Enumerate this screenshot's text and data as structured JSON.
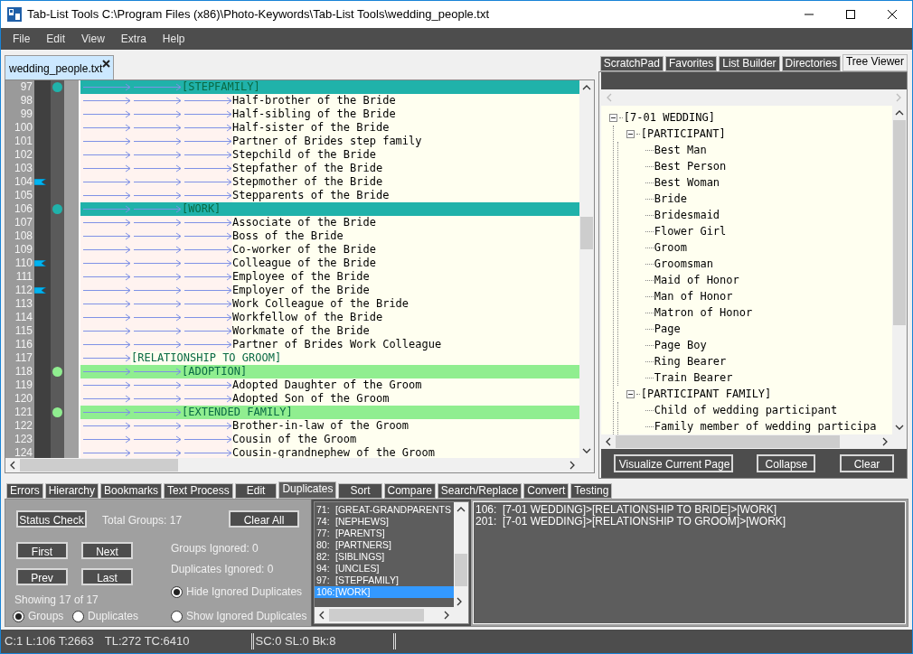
{
  "window": {
    "title": "Tab-List Tools C:\\Program Files (x86)\\Photo-Keywords\\Tab-List Tools\\wedding_people.txt"
  },
  "menu": [
    "File",
    "Edit",
    "View",
    "Extra",
    "Help"
  ],
  "document_tabs": [
    {
      "label": "wedding_people.txt",
      "selected": true
    }
  ],
  "editor": {
    "lines": [
      {
        "children": [
          {
            "number": "97",
            "kind": "group",
            "text": "[STEPFAMILY]",
            "color": "#20b2aa",
            "bookmarked": false,
            "children": [
              {
                "number": "98",
                "kind": "item",
                "text": "Half-brother of the Bride",
                "bookmarked": false
              },
              {
                "number": "99",
                "kind": "item",
                "text": "Half-sibling of the Bride",
                "bookmarked": false
              },
              {
                "number": "100",
                "kind": "item",
                "text": "Half-sister of the Bride",
                "bookmarked": false
              },
              {
                "number": "101",
                "kind": "item",
                "text": "Partner of Brides step family",
                "bookmarked": false
              },
              {
                "number": "102",
                "kind": "item",
                "text": "Stepchild of the Bride",
                "bookmarked": false
              },
              {
                "number": "103",
                "kind": "item",
                "text": "Stepfather of the Bride",
                "bookmarked": false
              },
              {
                "number": "104",
                "kind": "item",
                "text": "Stepmother of the Bride",
                "bookmarked": true
              },
              {
                "number": "105",
                "kind": "item",
                "text": "Stepparents of the Bride",
                "bookmarked": false
              }
            ]
          },
          {
            "number": "106",
            "kind": "group",
            "text": "[WORK]",
            "color": "#20b2aa",
            "bookmarked": false,
            "children": [
              {
                "number": "107",
                "kind": "item",
                "text": "Associate of the Bride",
                "bookmarked": false
              },
              {
                "number": "108",
                "kind": "item",
                "text": "Boss of the Bride",
                "bookmarked": false
              },
              {
                "number": "109",
                "kind": "item",
                "text": "Co-worker of the Bride",
                "bookmarked": false
              },
              {
                "number": "110",
                "kind": "item",
                "text": "Colleague of the Bride",
                "bookmarked": true
              },
              {
                "number": "111",
                "kind": "item",
                "text": "Employee of the Bride",
                "bookmarked": false
              },
              {
                "number": "112",
                "kind": "item",
                "text": "Employer of the Bride",
                "bookmarked": true
              },
              {
                "number": "113",
                "kind": "item",
                "text": "Work Colleague of the Bride",
                "bookmarked": false
              },
              {
                "number": "114",
                "kind": "item",
                "text": "Workfellow of the Bride",
                "bookmarked": false
              },
              {
                "number": "115",
                "kind": "item",
                "text": "Workmate of the Bride",
                "bookmarked": false
              },
              {
                "number": "116",
                "kind": "item",
                "text": "Partner of Brides Work Colleague",
                "bookmarked": false
              }
            ]
          }
        ]
      },
      {
        "number": "117",
        "kind": "group",
        "text": "[RELATIONSHIP TO GROOM]",
        "bookmarked": false,
        "children": [
          {
            "number": "118",
            "kind": "group",
            "text": "[ADOPTION]",
            "color": "#90ee90",
            "bookmarked": false,
            "children": [
              {
                "number": "119",
                "kind": "item",
                "text": "Adopted Daughter of the Groom",
                "bookmarked": false
              },
              {
                "number": "120",
                "kind": "item",
                "text": "Adopted Son of the Groom",
                "bookmarked": false
              }
            ]
          },
          {
            "number": "121",
            "kind": "group",
            "text": "[EXTENDED FAMILY]",
            "color": "#90ee90",
            "bookmarked": false,
            "children": [
              {
                "number": "122",
                "kind": "item",
                "text": "Brother-in-law of the Groom",
                "bookmarked": false
              },
              {
                "number": "123",
                "kind": "item",
                "text": "Cousin of the Groom",
                "bookmarked": false
              },
              {
                "number": "124",
                "kind": "item",
                "text": "Cousin-grandnephew of the Groom",
                "bookmarked": false
              }
            ]
          }
        ]
      }
    ]
  },
  "side_tabs": [
    {
      "label": "ScratchPad",
      "selected": false
    },
    {
      "label": "Favorites",
      "selected": false
    },
    {
      "label": "List Builder",
      "selected": false
    },
    {
      "label": "Directories",
      "selected": false
    },
    {
      "label": "Tree Viewer",
      "selected": true
    }
  ],
  "tree": {
    "nodes": [
      {
        "label": "[7-01 WEDDING]",
        "expanded": true,
        "children": [
          {
            "label": "[PARTICIPANT]",
            "expanded": true,
            "children": [
              {
                "label": "Best Man"
              },
              {
                "label": "Best Person"
              },
              {
                "label": "Best Woman"
              },
              {
                "label": "Bride"
              },
              {
                "label": "Bridesmaid"
              },
              {
                "label": "Flower Girl"
              },
              {
                "label": "Groom"
              },
              {
                "label": "Groomsman"
              },
              {
                "label": "Maid of Honor"
              },
              {
                "label": "Man of Honor"
              },
              {
                "label": "Matron of Honor"
              },
              {
                "label": "Page"
              },
              {
                "label": "Page Boy"
              },
              {
                "label": "Ring Bearer"
              },
              {
                "label": "Train Bearer"
              }
            ]
          },
          {
            "label": "[PARTICIPANT FAMILY]",
            "expanded": true,
            "children": [
              {
                "label": "Child of wedding participant"
              },
              {
                "label": "Family member of wedding participa"
              }
            ]
          }
        ]
      }
    ]
  },
  "tree_buttons": [
    "Visualize Current Page",
    "Collapse",
    "Clear"
  ],
  "bottom_tabs": [
    {
      "label": "Errors",
      "selected": false
    },
    {
      "label": "Hierarchy",
      "selected": false
    },
    {
      "label": "Bookmarks",
      "selected": false
    },
    {
      "label": "Text Process",
      "selected": false
    },
    {
      "label": "Edit",
      "selected": false
    },
    {
      "label": "Duplicates",
      "selected": true
    },
    {
      "label": "Sort",
      "selected": false
    },
    {
      "label": "Compare",
      "selected": false
    },
    {
      "label": "Search/Replace",
      "selected": false
    },
    {
      "label": "Convert",
      "selected": false
    },
    {
      "label": "Testing",
      "selected": false
    }
  ],
  "duplicates": {
    "status_button": "Status Check",
    "total_groups": "Total Groups: 17",
    "clear_button": "Clear All",
    "nav_buttons": [
      "First",
      "Next",
      "Prev",
      "Last"
    ],
    "groups_ignored": "Groups Ignored: 0",
    "duplicates_ignored": "Duplicates Ignored: 0",
    "showing": "Showing 17 of 17",
    "view_options": [
      {
        "label": "Groups",
        "selected": true
      },
      {
        "label": "Duplicates",
        "selected": false
      }
    ],
    "ignore_options": [
      {
        "label": "Hide Ignored Duplicates",
        "selected": true
      },
      {
        "label": "Show Ignored Duplicates",
        "selected": false
      }
    ],
    "groups": [
      {
        "number": "71:",
        "label": "[GREAT-GRANDPARENTS",
        "selected": false
      },
      {
        "number": "74:",
        "label": "[NEPHEWS]",
        "selected": false
      },
      {
        "number": "77:",
        "label": "[PARENTS]",
        "selected": false
      },
      {
        "number": "80:",
        "label": "[PARTNERS]",
        "selected": false
      },
      {
        "number": "82:",
        "label": "[SIBLINGS]",
        "selected": false
      },
      {
        "number": "94:",
        "label": "[UNCLES]",
        "selected": false
      },
      {
        "number": "97:",
        "label": "[STEPFAMILY]",
        "selected": false
      },
      {
        "number": "106:",
        "label": "[WORK]",
        "selected": true
      }
    ],
    "results": [
      {
        "number": "106:",
        "path": "[7-01 WEDDING]>[RELATIONSHIP TO BRIDE]>[WORK]"
      },
      {
        "number": "201:",
        "path": "[7-01 WEDDING]>[RELATIONSHIP TO GROOM]>[WORK]"
      }
    ]
  },
  "status_bar": {
    "position": "C:1 L:106 T:2663",
    "totals": "TL:272 TC:6410",
    "selection": "SC:0 SL:0 Bk:8"
  }
}
